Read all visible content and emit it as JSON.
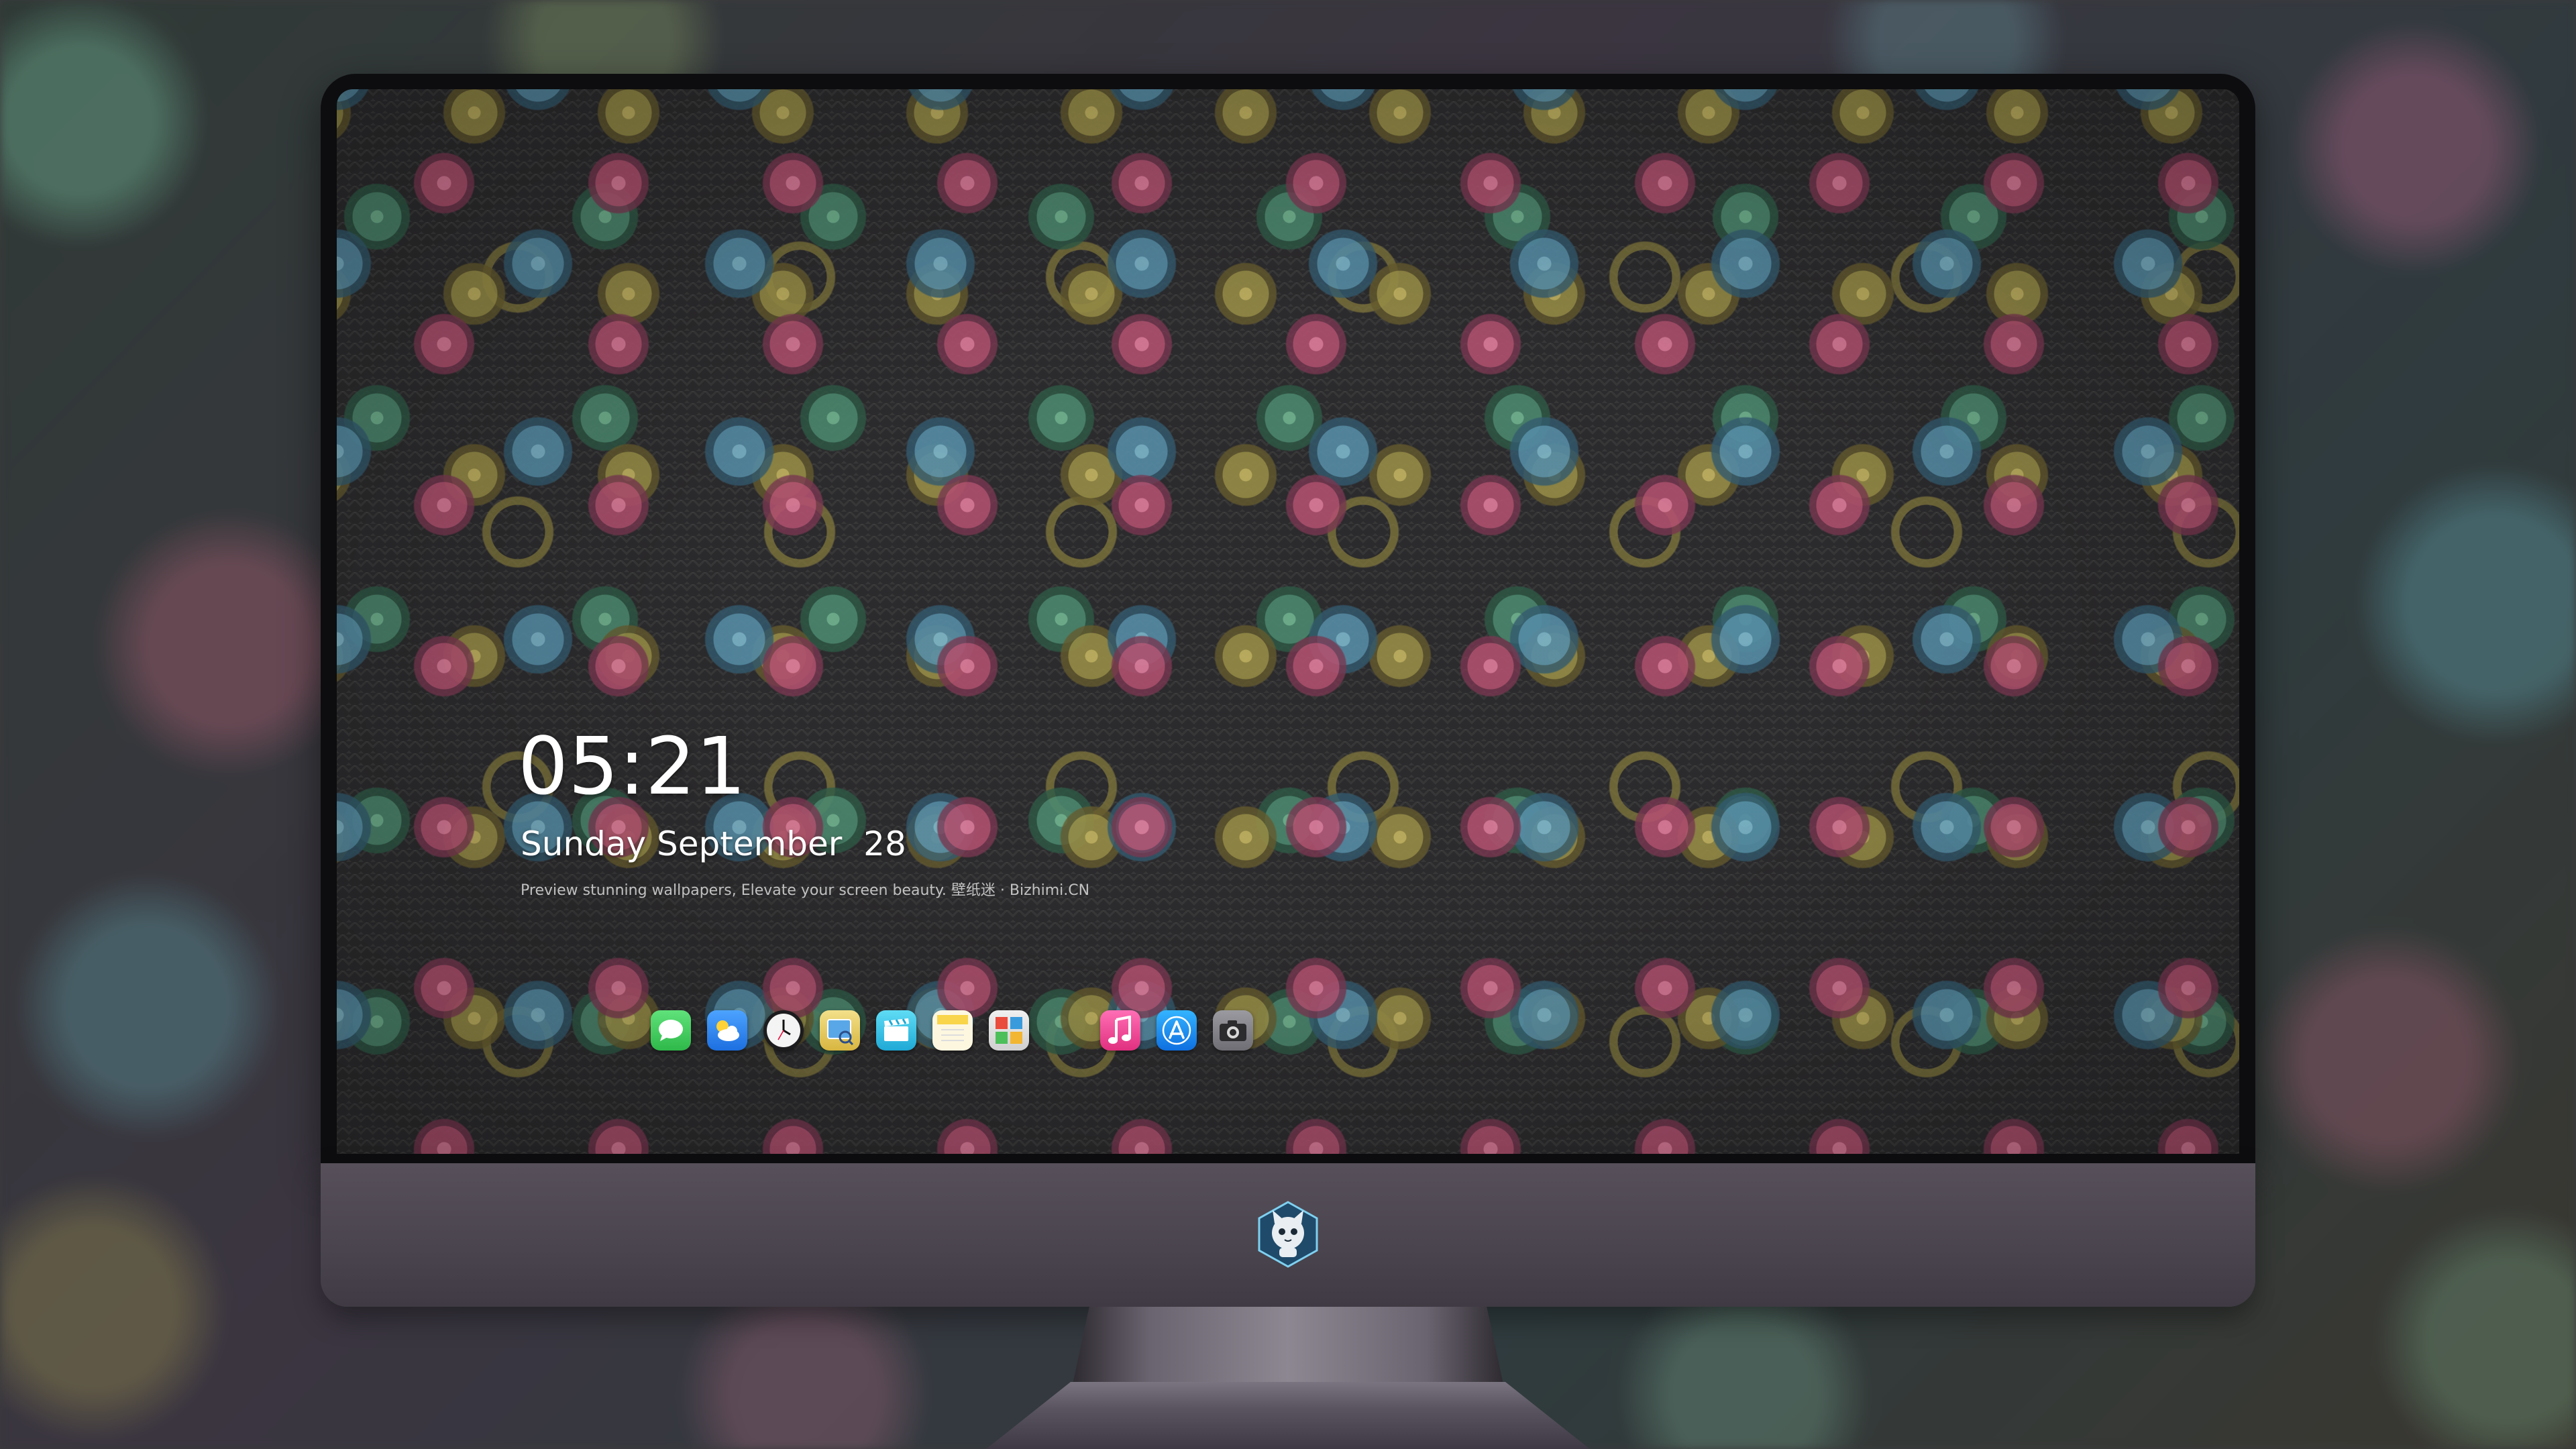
{
  "lock_screen": {
    "time": "05:21",
    "date": "Sunday September  28",
    "caption": "Preview stunning wallpapers, Elevate your screen beauty. 壁纸迷 · Bizhimi.CN"
  },
  "dock": {
    "apps": [
      {
        "name": "Messages",
        "icon": "messages-icon",
        "color": "#34c759"
      },
      {
        "name": "Weather",
        "icon": "weather-icon",
        "color": "#3a8ef0"
      },
      {
        "name": "Clock",
        "icon": "clock-icon",
        "color": "#f2f2f2"
      },
      {
        "name": "Preview",
        "icon": "preview-icon",
        "color": "#e0c65a"
      },
      {
        "name": "Clips",
        "icon": "clapper-icon",
        "color": "#38c3e8"
      },
      {
        "name": "Notes",
        "icon": "notes-icon",
        "color": "#f8d54a"
      },
      {
        "name": "Photo Booth",
        "icon": "photo-grid-icon",
        "color": "#e8e8e8"
      },
      {
        "name": "Music",
        "icon": "music-note-icon",
        "color": "#f0489c"
      },
      {
        "name": "App Store",
        "icon": "app-store-icon",
        "color": "#1e8df2"
      },
      {
        "name": "Camera",
        "icon": "camera-icon",
        "color": "#8e8e93"
      }
    ]
  },
  "colors": {
    "monitor_chin": "#4a444e",
    "bezel": "#0d0d0f",
    "text": "#ffffff"
  },
  "brand_logo": "cat-mascot-logo"
}
